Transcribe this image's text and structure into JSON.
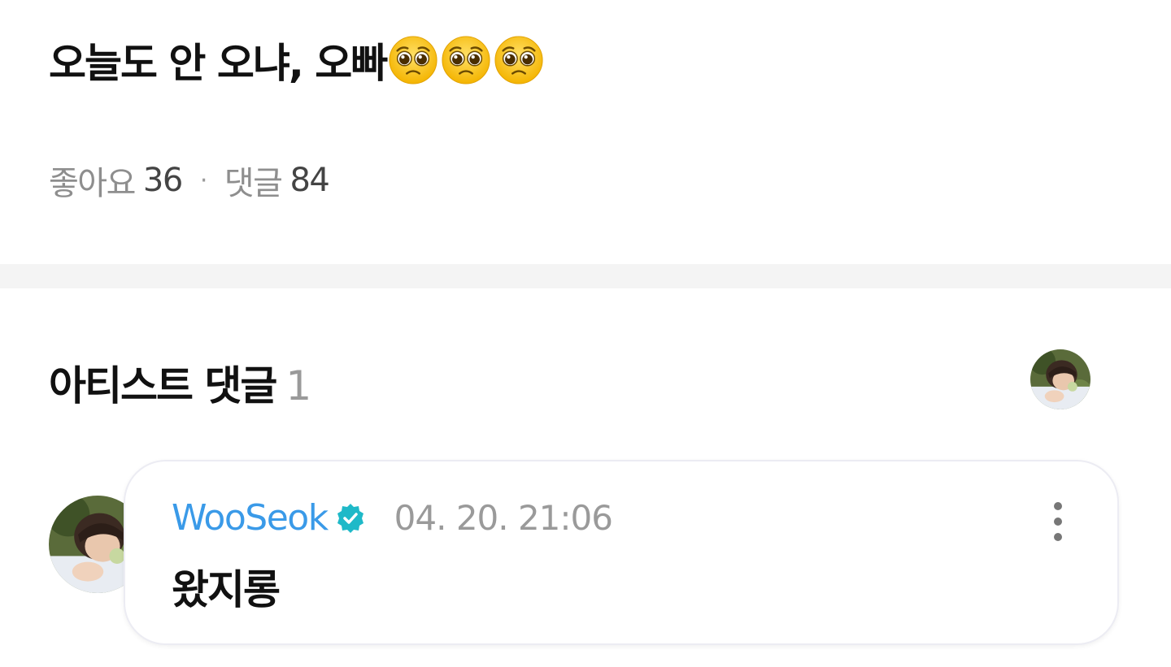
{
  "post": {
    "title": "오늘도 안 오냐, 오빠",
    "title_emojis": [
      "pleading-face-emoji",
      "pleading-face-emoji",
      "pleading-face-emoji"
    ],
    "likes_label": "좋아요",
    "likes_count": "36",
    "separator": "·",
    "comments_label": "댓글",
    "comments_count": "84"
  },
  "artist_comments": {
    "heading": "아티스트 댓글",
    "count": "1",
    "header_avatar_icon": "artist-avatar",
    "items": [
      {
        "author": "WooSeok",
        "verified_icon": "verified-badge-icon",
        "timestamp": "04. 20. 21:06",
        "text": "왔지롱",
        "avatar_icon": "artist-avatar",
        "more_icon": "more-vertical-icon"
      }
    ]
  },
  "colors": {
    "author_blue": "#3a9ae8",
    "verified_teal": "#1fb9c8",
    "muted_text": "#9a9a9a",
    "divider_band": "#f4f4f4"
  }
}
